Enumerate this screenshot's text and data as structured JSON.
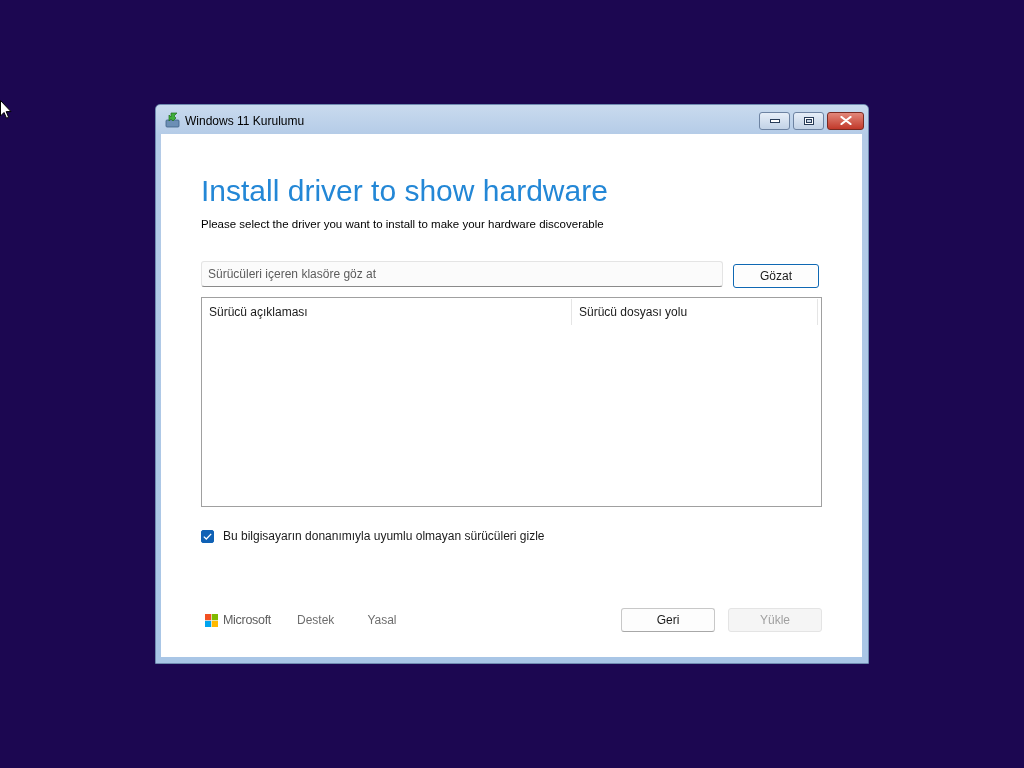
{
  "window": {
    "title": "Windows 11 Kurulumu"
  },
  "heading": "Install driver to show hardware",
  "subheading": "Please select the driver you want to install to make your hardware discoverable",
  "folder_field": {
    "placeholder": "Sürücüleri içeren klasöre göz at"
  },
  "browse_button": {
    "label": "Gözat"
  },
  "driver_table": {
    "columns": [
      "Sürücü açıklaması",
      "Sürücü dosyası yolu"
    ]
  },
  "hide_incompatible": {
    "label": "Bu bilgisayarın donanımıyla uyumlu olmayan sürücüleri gizle",
    "checked": true
  },
  "footer": {
    "brand": "Microsoft",
    "links": [
      "Destek",
      "Yasal"
    ]
  },
  "buttons": [
    {
      "label": "Geri",
      "disabled": false
    },
    {
      "label": "Yükle",
      "disabled": true
    }
  ]
}
